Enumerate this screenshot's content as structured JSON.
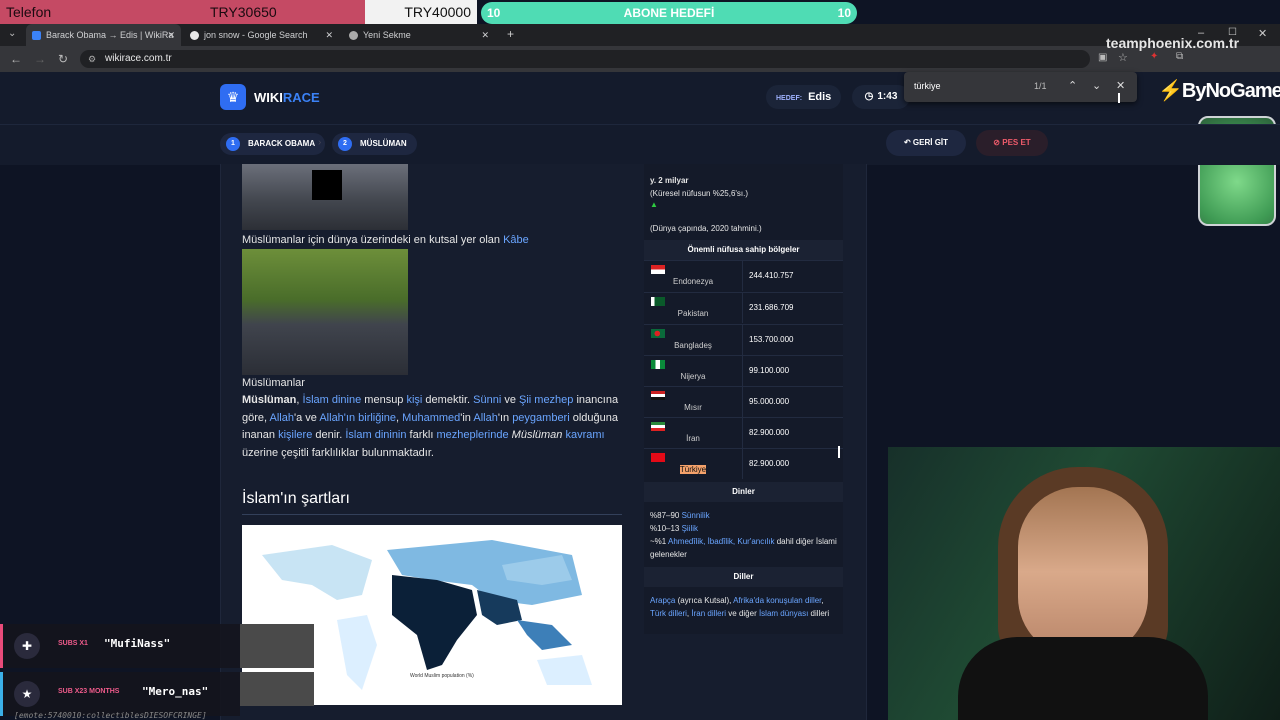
{
  "overlay": {
    "donate_left": "Telefon",
    "donate_mid": "TRY30650",
    "donate_right": "TRY40000",
    "subgoal_left": "10",
    "subgoal_title": "ABONE HEDEFİ",
    "subgoal_right": "10",
    "team": "teamphoenix.com.tr",
    "sponsor": "ByNoGame",
    "alerts": [
      {
        "label": "SUBS X1",
        "user": "\"MufiNass\""
      },
      {
        "label": "SUB X23 MONTHS",
        "user": "\"Mero_nas\""
      }
    ],
    "emote_text": "[emote:5740010:collectiblesDIESOFCRINGE]"
  },
  "browser": {
    "tabs": [
      {
        "label": "Barack Obama → Edis | WikiRa"
      },
      {
        "label": "jon snow - Google Search"
      },
      {
        "label": "Yeni Sekme"
      }
    ],
    "url": "wikirace.com.tr",
    "find_query": "türkiye",
    "find_count": "1/1"
  },
  "game": {
    "logo_a": "WIKI",
    "logo_b": "RACE",
    "target_label": "HEDEF:",
    "target_value": "Edis",
    "timer": "1:43",
    "crumbs": [
      {
        "num": "1",
        "label": "BARACK OBAMA"
      },
      {
        "num": "2",
        "label": "MÜSLÜMAN"
      }
    ],
    "back_label": "GERİ GİT",
    "quit_label": "PES ET"
  },
  "article": {
    "cap1_text": "Müslümanlar için dünya üzerindeki en kutsal yer olan ",
    "cap1_link": "Kâbe",
    "cap2": "Müslümanlar",
    "para": {
      "bold": "Müslüman",
      "l1": "İslam dinine",
      "t1": " mensup ",
      "l2": "kişi",
      "t2": " demektir. ",
      "l3": "Sünni",
      "t3": " ve ",
      "l4": "Şii mezhep",
      "t4": " inancına göre, ",
      "l5": "Allah",
      "t5": "'a ve ",
      "l6": "Allah'ın birliğine",
      "t6": ", ",
      "l7": "Muhammed",
      "t7": "'in ",
      "l8": "Allah",
      "t8": "'ın ",
      "l9": "peygamberi",
      "t9": " olduğuna inanan ",
      "l10": "kişilere",
      "t10": " denir. ",
      "l11": "İslam dininin",
      "t11": " farklı ",
      "l12": "mezheplerinde",
      "t12": " ",
      "i1": "Müslüman",
      "l13": "kavramı",
      "t13": " üzerine çeşitli farklılıklar bulunmaktadır."
    },
    "section_title": "İslam'ın şartları",
    "map_legend": "World Muslim population (%)"
  },
  "infobox": {
    "pop": "y. 2 milyar",
    "pop_share": "(Küresel nüfusun %25,6'sı.)",
    "pop_note": "(Dünya çapında, 2020 tahmini.)",
    "regions_title": "Önemli nüfusa sahip bölgeler",
    "regions": [
      {
        "name": "Endonezya",
        "value": "244.410.757"
      },
      {
        "name": "Pakistan",
        "value": "231.686.709"
      },
      {
        "name": "Bangladeş",
        "value": "153.700.000"
      },
      {
        "name": "Nijerya",
        "value": "99.100.000"
      },
      {
        "name": "Mısır",
        "value": "95.000.000"
      },
      {
        "name": "İran",
        "value": "82.900.000"
      },
      {
        "name": "Türkiye",
        "value": "82.900.000"
      }
    ],
    "religions_title": "Dinler",
    "rel1_a": "%87–90 ",
    "rel1_b": "Sünnilik",
    "rel2_a": "%10–13 ",
    "rel2_b": "Şiilik",
    "rel3_a": "~%1 ",
    "rel3_b": "Ahmedîlik, İbadîlik, Kur'ancılık",
    "rel3_c": " dahil diğer İslami gelenekler",
    "languages_title": "Diller",
    "lang_a": "Arapça",
    "lang_b": " (ayrıca Kutsal), ",
    "lang_c": "Afrika'da konuşulan diller",
    "lang_d": ", ",
    "lang_e": "Türk dilleri",
    "lang_f": ", ",
    "lang_g": "İran dilleri",
    "lang_h": " ve diğer ",
    "lang_i": "İslam dünyası",
    "lang_j": " dilleri"
  }
}
